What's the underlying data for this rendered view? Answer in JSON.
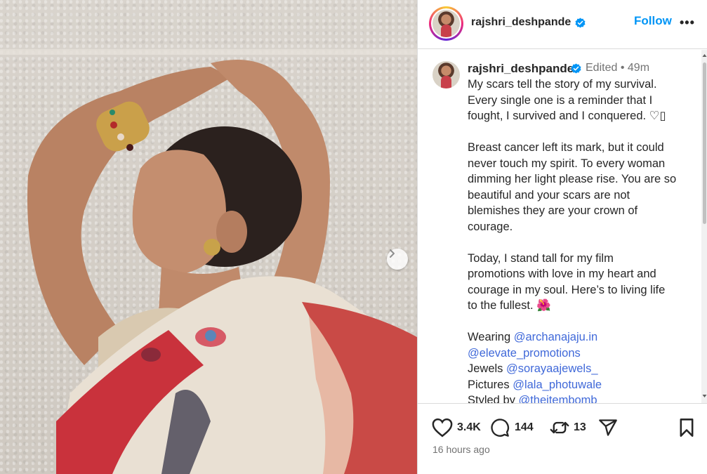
{
  "photo": {
    "next_icon": "chevron-right-icon"
  },
  "header": {
    "username": "rajshri_deshpande",
    "follow_label": "Follow",
    "more_label": "•••"
  },
  "caption": {
    "username": "rajshri_deshpande",
    "edited_label": "Edited",
    "separator": "•",
    "time": "49m",
    "paragraphs": [
      [
        "My scars tell the story of my survival.",
        "Every single one is a reminder that I",
        "fought, I survived and I conquered. ♡▯"
      ],
      [
        "Breast cancer left its mark, but it could",
        "never touch my spirit. To every woman",
        "dimming her light please rise. You are so",
        "beautiful and your scars are not",
        "blemishes they are your crown of",
        "courage."
      ],
      [
        "Today, I stand tall for my film",
        "promotions with love in my heart and",
        "courage in my soul. Here’s to living life",
        "to the fullest. 🌺"
      ]
    ],
    "credits": {
      "wearing_label": "Wearing",
      "wearing_mention_1": "@archanajaju.in",
      "wearing_mention_2": "@elevate_promotions",
      "jewels_label": "Jewels",
      "jewels_mention": "@sorayaajewels_",
      "pictures_label": "Pictures",
      "pictures_mention": "@lala_photuwale",
      "styled_label": "Styled by",
      "styled_mention": "@theitembomb"
    }
  },
  "actions": {
    "likes": "3.4K",
    "comments": "144",
    "reposts": "13",
    "time_ago": "16 hours ago"
  },
  "colors": {
    "accent": "#0095f6",
    "mention": "#4069d9",
    "verified": "#0095f6"
  }
}
